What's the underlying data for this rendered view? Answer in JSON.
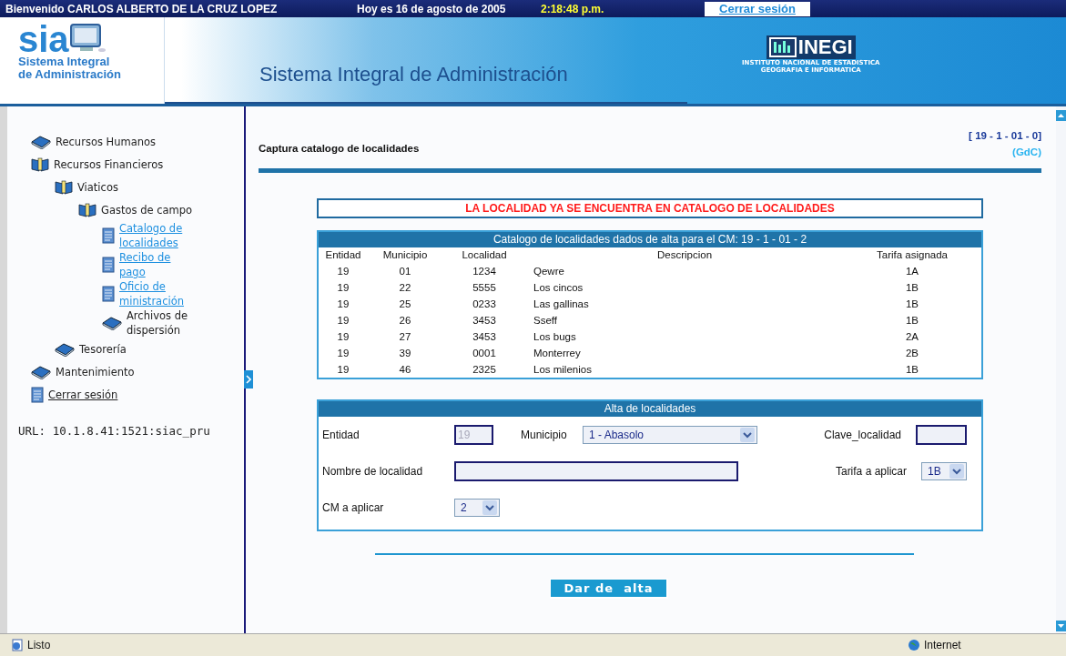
{
  "top_bar": {
    "welcome": "Bienvenido CARLOS ALBERTO DE LA CRUZ LOPEZ",
    "date": "Hoy es 16 de agosto de 2005",
    "time": "2:18:48 p.m.",
    "logout": "Cerrar sesión"
  },
  "header": {
    "logo_word": "sia",
    "logo_sub1": "Sistema Integral",
    "logo_sub2": "de Administración",
    "title": "Sistema Integral de Administración",
    "org_logo": "INEGI",
    "org_line1": "INSTITUTO NACIONAL DE ESTADISTICA",
    "org_line2": "GEOGRAFIA E INFORMATICA"
  },
  "sidebar": {
    "items": [
      {
        "label": "Recursos Humanos",
        "kind": "book"
      },
      {
        "label": "Recursos Financieros",
        "kind": "open-book",
        "children": [
          {
            "label": "Viaticos",
            "kind": "open-book",
            "children": [
              {
                "label": "Gastos de campo",
                "kind": "open-book",
                "children": [
                  {
                    "label": "Catalogo de localidades",
                    "kind": "link"
                  },
                  {
                    "label": "Recibo de pago",
                    "kind": "link"
                  },
                  {
                    "label": "Oficio de ministración",
                    "kind": "link"
                  },
                  {
                    "label": "Archivos de dispersión",
                    "kind": "book"
                  }
                ]
              }
            ]
          },
          {
            "label": "Tesorería",
            "kind": "book"
          }
        ]
      },
      {
        "label": "Mantenimiento",
        "kind": "book"
      },
      {
        "label": "Cerrar sesión",
        "kind": "plain-link"
      }
    ],
    "url": "URL: 10.1.8.41:1521:siac_pru"
  },
  "page": {
    "title": "Captura catalogo de localidades",
    "code": "[ 19 - 1 - 01 - 0]",
    "tag": "(GdC)"
  },
  "alert": "LA LOCALIDAD YA SE ENCUENTRA EN CATALOGO DE LOCALIDADES",
  "table": {
    "title": "Catalogo de localidades dados de alta para el CM: 19 - 1 - 01 - 2",
    "columns": [
      "Entidad",
      "Municipio",
      "Localidad",
      "Descripcion",
      "Tarifa asignada"
    ],
    "rows": [
      [
        "19",
        "01",
        "1234",
        "Qewre",
        "1A"
      ],
      [
        "19",
        "22",
        "5555",
        "Los cincos",
        "1B"
      ],
      [
        "19",
        "25",
        "0233",
        "Las gallinas",
        "1B"
      ],
      [
        "19",
        "26",
        "3453",
        "Sseff",
        "1B"
      ],
      [
        "19",
        "27",
        "3453",
        "Los bugs",
        "2A"
      ],
      [
        "19",
        "39",
        "0001",
        "Monterrey",
        "2B"
      ],
      [
        "19",
        "46",
        "2325",
        "Los milenios",
        "1B"
      ]
    ]
  },
  "form": {
    "title": "Alta de localidades",
    "rows": [
      [
        {
          "label": "Entidad",
          "kind": "text",
          "value": "19",
          "disabled": true
        },
        {
          "label": "Municipio",
          "kind": "select",
          "value": "1 - Abasolo"
        },
        {
          "label": "Clave_localidad",
          "kind": "text"
        }
      ],
      [
        {
          "label": "Nombre de localidad",
          "kind": "wide-text"
        },
        "",
        {
          "label": "Tarifa a aplicar",
          "kind": "select",
          "value": "1B"
        }
      ],
      [
        {
          "label": "CM a aplicar",
          "kind": "select",
          "value": "2"
        }
      ]
    ]
  },
  "submit": "Dar de  alta",
  "status_bar": {
    "status": "Listo",
    "zone": "Internet"
  }
}
